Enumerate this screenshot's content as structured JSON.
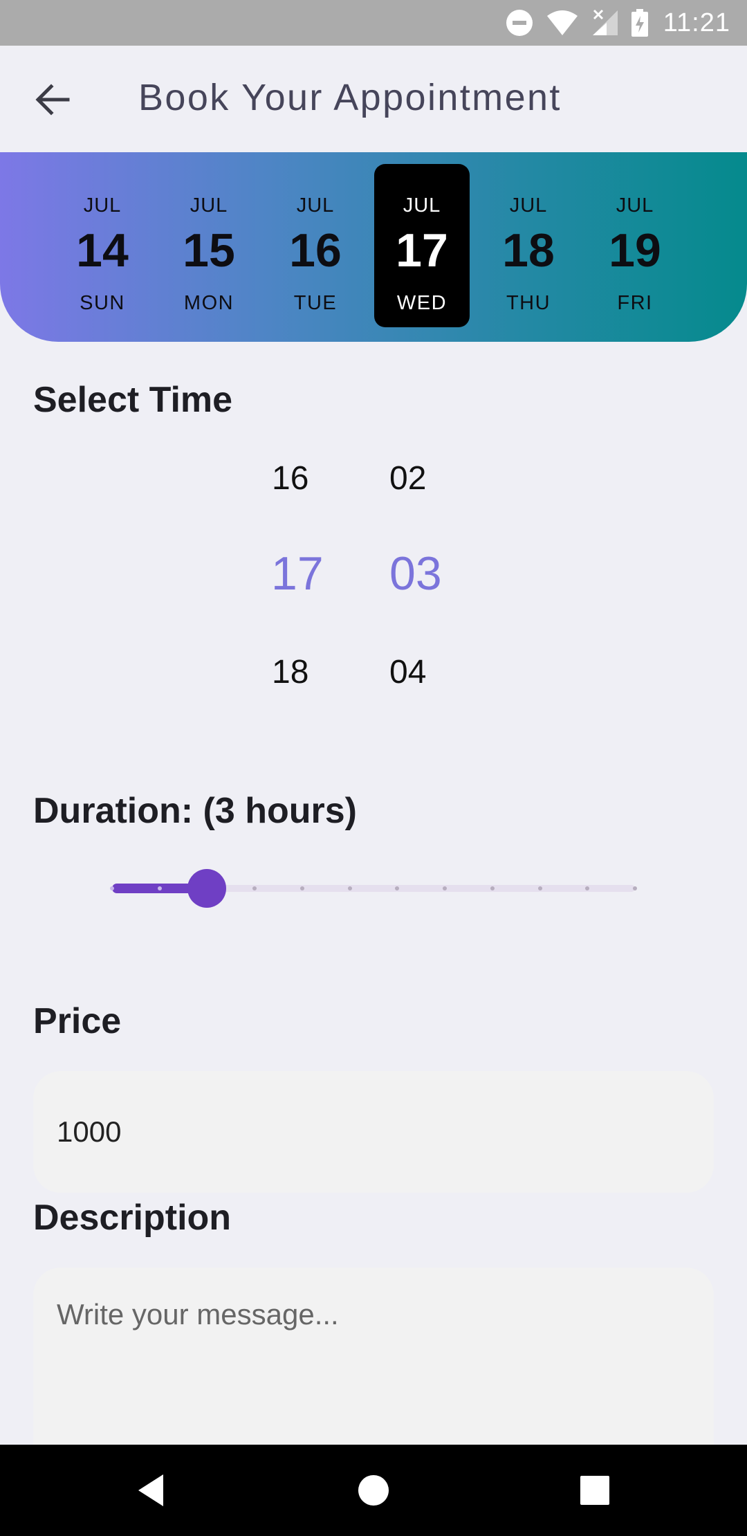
{
  "status_bar": {
    "time": "11:21",
    "icons": [
      "do-not-disturb-icon",
      "wifi-icon",
      "no-signal-icon",
      "battery-charging-icon"
    ]
  },
  "app_bar": {
    "title": "Book Your Appointment",
    "back_icon": "arrow-left-icon"
  },
  "dates": [
    {
      "month": "JUL",
      "day": "14",
      "weekday": "SUN",
      "selected": false
    },
    {
      "month": "JUL",
      "day": "15",
      "weekday": "MON",
      "selected": false
    },
    {
      "month": "JUL",
      "day": "16",
      "weekday": "TUE",
      "selected": false
    },
    {
      "month": "JUL",
      "day": "17",
      "weekday": "WED",
      "selected": true
    },
    {
      "month": "JUL",
      "day": "18",
      "weekday": "THU",
      "selected": false
    },
    {
      "month": "JUL",
      "day": "19",
      "weekday": "FRI",
      "selected": false
    }
  ],
  "time_section": {
    "label": "Select Time",
    "hours": [
      "16",
      "17",
      "18"
    ],
    "minutes": [
      "02",
      "03",
      "04"
    ],
    "selected_hour": "17",
    "selected_minute": "03"
  },
  "duration": {
    "label": "Duration: (3 hours)",
    "value": 3,
    "min": 1,
    "max": 12
  },
  "price": {
    "label": "Price",
    "value": "1000"
  },
  "description": {
    "label": "Description",
    "placeholder": "Write your message..."
  },
  "colors": {
    "accent": "#6f3fc4",
    "picker_selected": "#7b74db",
    "gradient_start": "#7d78e6",
    "gradient_end": "#058a8d"
  }
}
